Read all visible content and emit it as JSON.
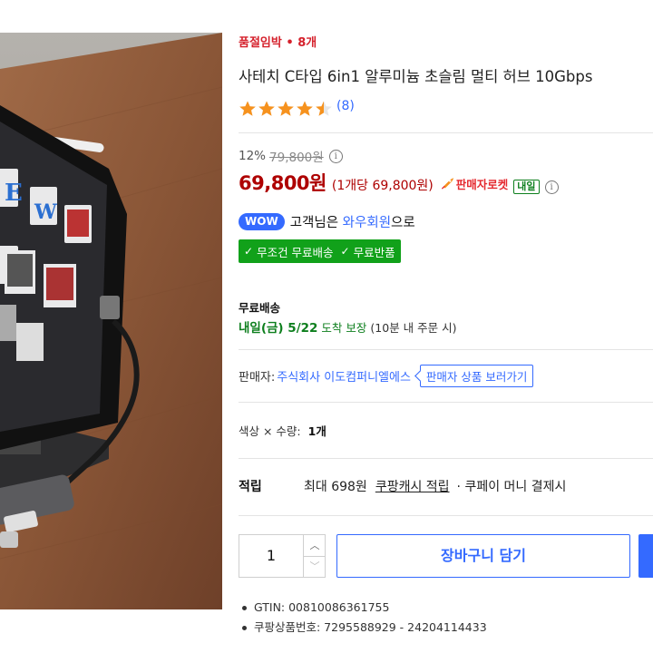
{
  "product": {
    "sellout_badge": "품절임박 • 8개",
    "title": "사테치 C타입 6in1 알루미늄 초슬림 멀티 허브 10Gbps",
    "rating": 4.5,
    "review_count": "(8)"
  },
  "price": {
    "discount_rate": "12%",
    "original_price": "79,800원",
    "sale_price": "69,800원",
    "unit_price": "(1개당 69,800원)",
    "seller_rocket": "판매자로켓",
    "tomorrow_tag": "내일"
  },
  "wow": {
    "badge": "WOW",
    "text_prefix": "고객님은",
    "member": "와우회원",
    "text_suffix": "으로"
  },
  "benefits": {
    "free_shipping": "무조건 무료배송",
    "free_return": "무료반품"
  },
  "shipping": {
    "label": "무료배송",
    "date": "내일(금) 5/22",
    "guarantee": "도착 보장",
    "note": "(10분 내 주문 시)"
  },
  "seller": {
    "label": "판매자:",
    "name": "주식회사 이도컴퍼니엘에스",
    "shop_button": "판매자 상품 보러가기"
  },
  "option": {
    "label": "색상 × 수량:",
    "value": "1개"
  },
  "reward": {
    "label": "적립",
    "max": "최대 698원",
    "link": "쿠팡캐시 적립",
    "pay": "· 쿠페이 머니 결제시"
  },
  "purchase": {
    "quantity": "1",
    "up_arrow": "︿",
    "down_arrow": "﹀",
    "cart_button": "장바구니 담기"
  },
  "details": [
    "GTIN: 00810086361755",
    "쿠팡상품번호: 7295588929 - 24204114433"
  ],
  "colors": {
    "price_red": "#ae0000",
    "link_blue": "#346aff",
    "delivery_green": "#0e7f1e",
    "benefit_green": "#11a11a",
    "star_orange": "#f6921e"
  }
}
